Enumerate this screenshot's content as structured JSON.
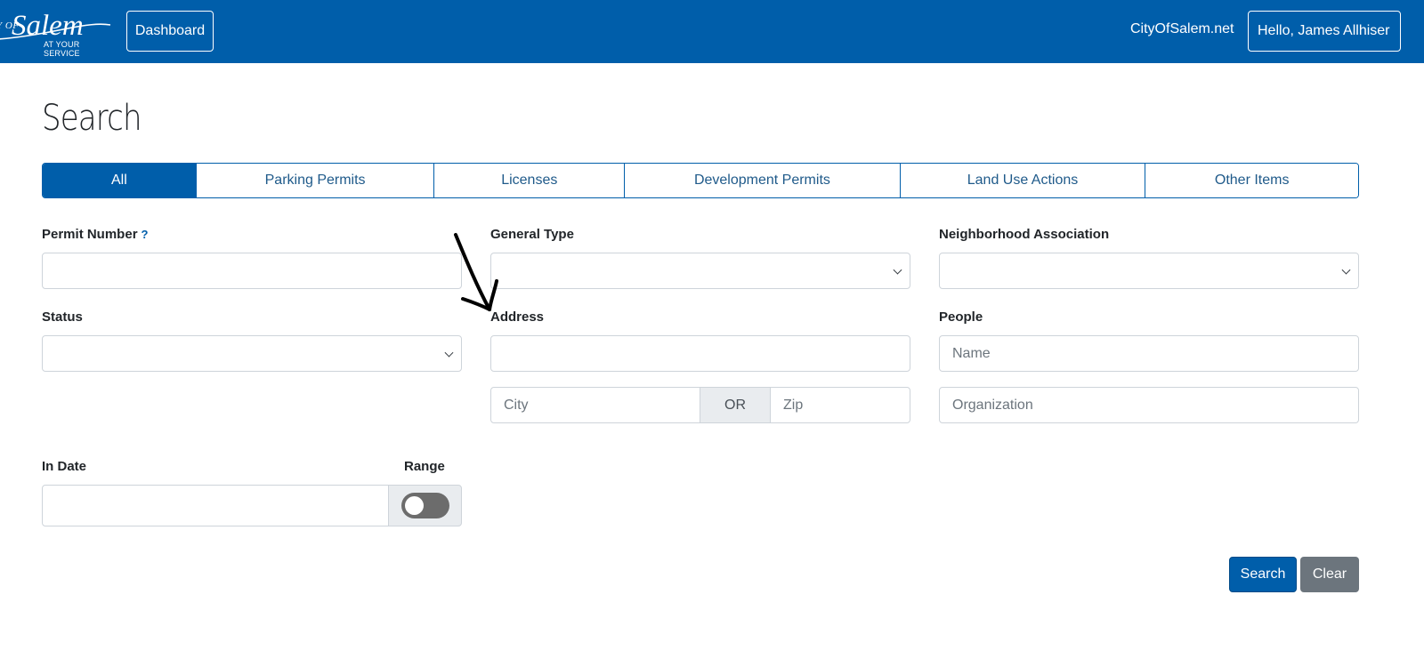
{
  "header": {
    "logo": {
      "of": "Y OF",
      "name": "Salem",
      "tagline": "AT YOUR SERVICE"
    },
    "dashboard_label": "Dashboard",
    "city_link": "CityOfSalem.net",
    "user_greeting": "Hello, James Allhiser"
  },
  "page": {
    "title": "Search"
  },
  "tabs": [
    {
      "label": "All",
      "active": true
    },
    {
      "label": "Parking Permits",
      "active": false
    },
    {
      "label": "Licenses",
      "active": false
    },
    {
      "label": "Development Permits",
      "active": false
    },
    {
      "label": "Land Use Actions",
      "active": false
    },
    {
      "label": "Other Items",
      "active": false
    }
  ],
  "form": {
    "permit_number": {
      "label": "Permit Number",
      "help": "?",
      "value": ""
    },
    "general_type": {
      "label": "General Type",
      "value": ""
    },
    "neighborhood": {
      "label": "Neighborhood Association",
      "value": ""
    },
    "status": {
      "label": "Status",
      "value": ""
    },
    "address": {
      "label": "Address",
      "value": "",
      "city_placeholder": "City",
      "or_text": "OR",
      "zip_placeholder": "Zip"
    },
    "people": {
      "label": "People",
      "name_placeholder": "Name",
      "org_placeholder": "Organization"
    },
    "in_date": {
      "label": "In Date",
      "value": ""
    },
    "range": {
      "label": "Range",
      "enabled": false
    }
  },
  "actions": {
    "search_label": "Search",
    "clear_label": "Clear"
  },
  "colors": {
    "primary": "#005eaa",
    "secondary": "#6c757d",
    "border": "#ced4da"
  }
}
